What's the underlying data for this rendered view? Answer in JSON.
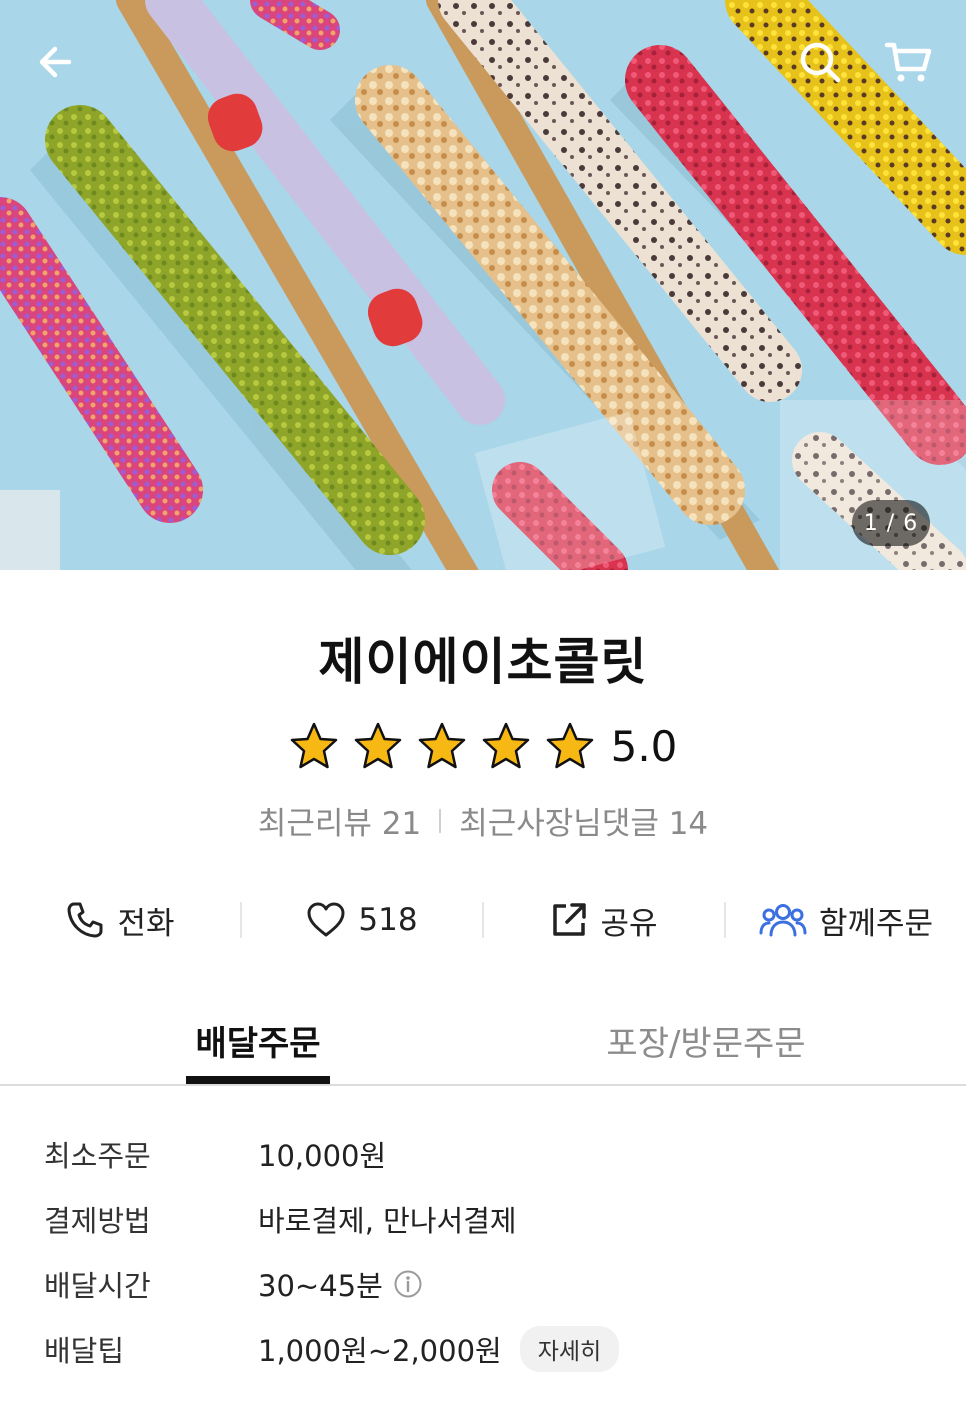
{
  "hero": {
    "page_indicator": "1 / 6",
    "icons": {
      "back": "arrow-left-icon",
      "search": "search-icon",
      "cart": "cart-icon"
    }
  },
  "store": {
    "name": "제이에이초콜릿",
    "rating": "5.0",
    "rating_stars": 5,
    "recent_reviews_label": "최근리뷰 21",
    "owner_replies_label": "최근사장님댓글 14"
  },
  "actions": [
    {
      "label": "전화",
      "icon": "phone-icon"
    },
    {
      "label": "518",
      "icon": "heart-icon"
    },
    {
      "label": "공유",
      "icon": "share-icon"
    },
    {
      "label": "함께주문",
      "icon": "group-order-icon"
    }
  ],
  "tabs": [
    {
      "label": "배달주문",
      "selected": true
    },
    {
      "label": "포장/방문주문",
      "selected": false
    }
  ],
  "info": [
    {
      "label": "최소주문",
      "value": "10,000원"
    },
    {
      "label": "결제방법",
      "value": "바로결제, 만나서결제"
    },
    {
      "label": "배달시간",
      "value": "30~45분",
      "icon": "info-icon"
    },
    {
      "label": "배달팁",
      "value": "1,000원~2,000원",
      "button": "자세히"
    }
  ],
  "colors": {
    "group_order_accent": "#3c6fe0",
    "star_fill": "#f7b814",
    "hero_background": "#a9d6e8"
  }
}
